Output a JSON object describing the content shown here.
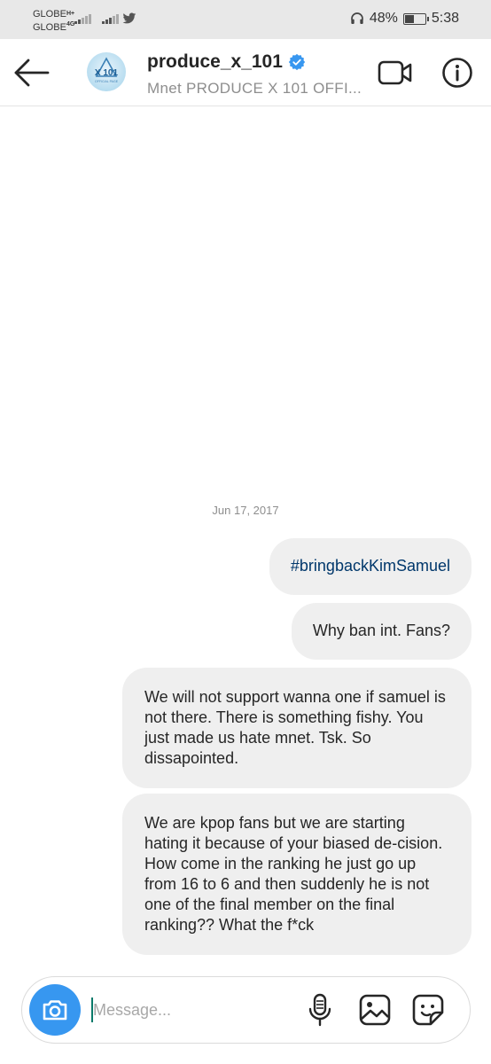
{
  "status_bar": {
    "carrier1": "GLOBE",
    "carrier2": "GLOBE",
    "net1": "H+",
    "net2": "4G",
    "battery_percent": "48%",
    "battery_level": 0.48,
    "time": "5:38",
    "icons": [
      "signal-icon",
      "twitter-icon",
      "headphones-icon",
      "battery-icon"
    ]
  },
  "header": {
    "username": "produce_x_101",
    "full_name": "Mnet PRODUCE X 101 OFFI...",
    "avatar_text": "X 101",
    "avatar_subtext": "OFFICIAL PAGE",
    "accent": "#3797f0"
  },
  "thread": {
    "date": "Jun 17, 2017",
    "messages": [
      {
        "text": "#bringbackKimSamuel",
        "is_hashtag": true
      },
      {
        "text": "Why ban int. Fans?"
      },
      {
        "text": "We will not support wanna one if samuel is not there. There is something fishy. You just made us hate mnet. Tsk. So dissapointed."
      },
      {
        "text": "We are kpop fans but we are starting hating it because of your biased de-cision. How come in the ranking he just go up from 16 to 6 and then suddenly he is not one of the final member on the final ranking?? What the f*ck"
      }
    ]
  },
  "composer": {
    "placeholder": "Message..."
  }
}
